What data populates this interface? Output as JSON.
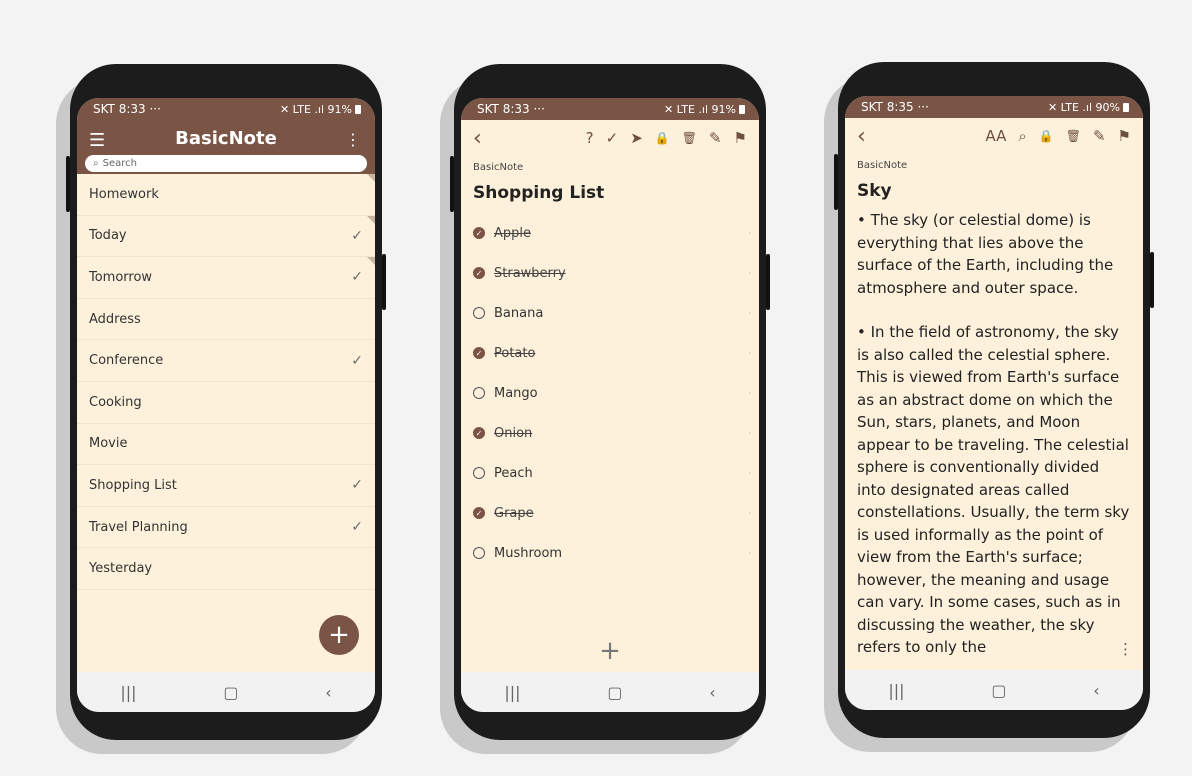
{
  "status1": {
    "left": "SKT 8:33 ···",
    "right": "✕ LTE .ıl 91%"
  },
  "status2": {
    "left": "SKT 8:33 ···",
    "right": "✕ LTE .ıl 91%"
  },
  "status3": {
    "left": "SKT 8:35 ···",
    "right": "✕ LTE .ıl 90%"
  },
  "home": {
    "title": "BasicNote",
    "search_placeholder": "Search",
    "notes": [
      {
        "label": "Homework",
        "checked": false
      },
      {
        "label": "Today",
        "checked": true
      },
      {
        "label": "Tomorrow",
        "checked": true
      },
      {
        "label": "Address",
        "checked": false
      },
      {
        "label": "Conference",
        "checked": true
      },
      {
        "label": "Cooking",
        "checked": false
      },
      {
        "label": "Movie",
        "checked": false
      },
      {
        "label": "Shopping List",
        "checked": true
      },
      {
        "label": "Travel Planning",
        "checked": true
      },
      {
        "label": "Yesterday",
        "checked": false
      }
    ]
  },
  "checklist": {
    "crumb": "BasicNote",
    "title": "Shopping List",
    "items": [
      {
        "label": "Apple",
        "done": true
      },
      {
        "label": "Strawberry",
        "done": true
      },
      {
        "label": "Banana",
        "done": false
      },
      {
        "label": "Potato",
        "done": true
      },
      {
        "label": "Mango",
        "done": false
      },
      {
        "label": "Onion",
        "done": true
      },
      {
        "label": "Peach",
        "done": false
      },
      {
        "label": "Grape",
        "done": true
      },
      {
        "label": "Mushroom",
        "done": false
      }
    ]
  },
  "note": {
    "crumb": "BasicNote",
    "title": "Sky",
    "font_size_label": "AA",
    "paragraphs": [
      "• The sky (or celestial dome) is everything that lies above the surface of the Earth, including the atmosphere and outer space.",
      "• In the field of astronomy, the sky is also called the celestial sphere. This is viewed from Earth's surface as an abstract dome on which the Sun, stars, planets, and Moon appear to be traveling. The celestial sphere is conventionally divided into designated areas called constellations. Usually, the term sky is used informally as the point of view from the Earth's surface; however, the meaning and usage can vary. In some cases, such as in discussing the weather, the sky refers to only the"
    ]
  },
  "icons": {
    "menu": "☰",
    "more": "⋮",
    "search": "⌕",
    "check": "✓",
    "back": "‹",
    "help": "?",
    "checkmark_circle": "✓",
    "send": "➤",
    "lock": "🔒",
    "trash": "🗑",
    "pencil": "✎",
    "bookmark": "⚑",
    "plus": "+",
    "nav_recent": "|||",
    "nav_home": "▢",
    "nav_back": "‹"
  },
  "colors": {
    "accent": "#7a5545",
    "background": "#fdf1dc"
  }
}
